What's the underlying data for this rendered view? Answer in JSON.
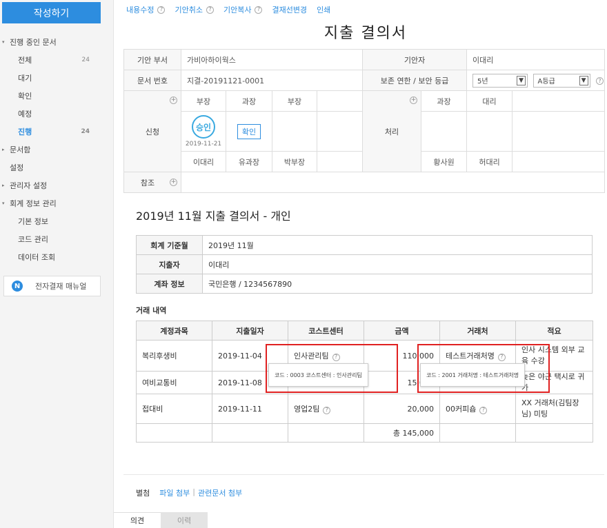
{
  "sidebar": {
    "compose_label": "작성하기",
    "nav": [
      {
        "label": "진행 중인 문서",
        "level": 0,
        "caret": "▾",
        "count": ""
      },
      {
        "label": "전체",
        "level": 1,
        "caret": "",
        "count": "24"
      },
      {
        "label": "대기",
        "level": 1,
        "caret": "",
        "count": ""
      },
      {
        "label": "확인",
        "level": 1,
        "caret": "",
        "count": ""
      },
      {
        "label": "예정",
        "level": 1,
        "caret": "",
        "count": ""
      },
      {
        "label": "진행",
        "level": 1,
        "caret": "",
        "count": "24",
        "active": true
      },
      {
        "label": "문서함",
        "level": 0,
        "caret": "▸",
        "count": ""
      },
      {
        "label": "설정",
        "level": 0,
        "caret": "",
        "count": ""
      },
      {
        "label": "관리자 설정",
        "level": 0,
        "caret": "▸",
        "count": ""
      },
      {
        "label": "회계 정보 관리",
        "level": 0,
        "caret": "▾",
        "count": ""
      },
      {
        "label": "기본 정보",
        "level": 1,
        "caret": "",
        "count": ""
      },
      {
        "label": "코드 관리",
        "level": 1,
        "caret": "",
        "count": ""
      },
      {
        "label": "데이터 조회",
        "level": 1,
        "caret": "",
        "count": ""
      }
    ],
    "manual_icon": "N",
    "manual_label": "전자결재 매뉴얼"
  },
  "toolbar": {
    "edit": "내용수정",
    "cancel": "기안취소",
    "copy": "기안복사",
    "change_line": "결재선변경",
    "print": "인쇄"
  },
  "doc_title": "지출 결의서",
  "approval": {
    "dept_label": "기안 부서",
    "dept_value": "가비아하이웍스",
    "drafter_label": "기안자",
    "drafter_value": "이대리",
    "docno_label": "문서 번호",
    "docno_value": "지결-20191121-0001",
    "retention_label": "보존 연한 / 보안 등급",
    "retention_value": "5년",
    "security_value": "A등급",
    "apply_label": "신청",
    "apply_positions": [
      "부장",
      "과장",
      "부장"
    ],
    "stamp_text": "승인",
    "stamp_date": "2019-11-21",
    "confirm_text": "확인",
    "apply_names": [
      "이대리",
      "유과장",
      "박부장"
    ],
    "process_label": "처리",
    "process_positions": [
      "과장",
      "대리"
    ],
    "process_names": [
      "황사원",
      "허대리"
    ],
    "ref_label": "참조",
    "plus": "+"
  },
  "section_title": "2019년 11월 지출 결의서 - 개인",
  "info": {
    "period_label": "회계 기준월",
    "period_value": "2019년 11월",
    "spender_label": "지출자",
    "spender_value": "이대리",
    "account_label": "계좌 정보",
    "account_value": "국민은행 / 1234567890"
  },
  "tx": {
    "title": "거래 내역",
    "headers": [
      "계정과목",
      "지출일자",
      "코스트센터",
      "금액",
      "거래처",
      "적요"
    ],
    "rows": [
      {
        "account": "복리후생비",
        "date": "2019-11-04",
        "center": "인사관리팀",
        "amount": "110,000",
        "vendor": "테스트거래처명",
        "memo": "인사 시스템 외부 교육 수강"
      },
      {
        "account": "여비교통비",
        "date": "2019-11-08",
        "center": "",
        "amount": "15,000",
        "vendor": "",
        "memo": "늦은 야근 택시로 귀가"
      },
      {
        "account": "접대비",
        "date": "2019-11-11",
        "center": "영업2팀",
        "amount": "20,000",
        "vendor": "00커피숍",
        "memo": "XX 거래처(김팀장님) 미팅"
      }
    ],
    "total": "총 145,000",
    "tip_center": "코드 : 0003   코스트센터 : 인사관리팀",
    "tip_vendor": "코드 : 2001   거래처명 : 테스트거래처명"
  },
  "footer": {
    "attach_label": "별첨",
    "file_link": "파일 첨부",
    "sep": "|",
    "related_link": "관련문서 첨부",
    "tab_opinion": "의견",
    "tab_history": "이력"
  },
  "help_glyph": "?"
}
